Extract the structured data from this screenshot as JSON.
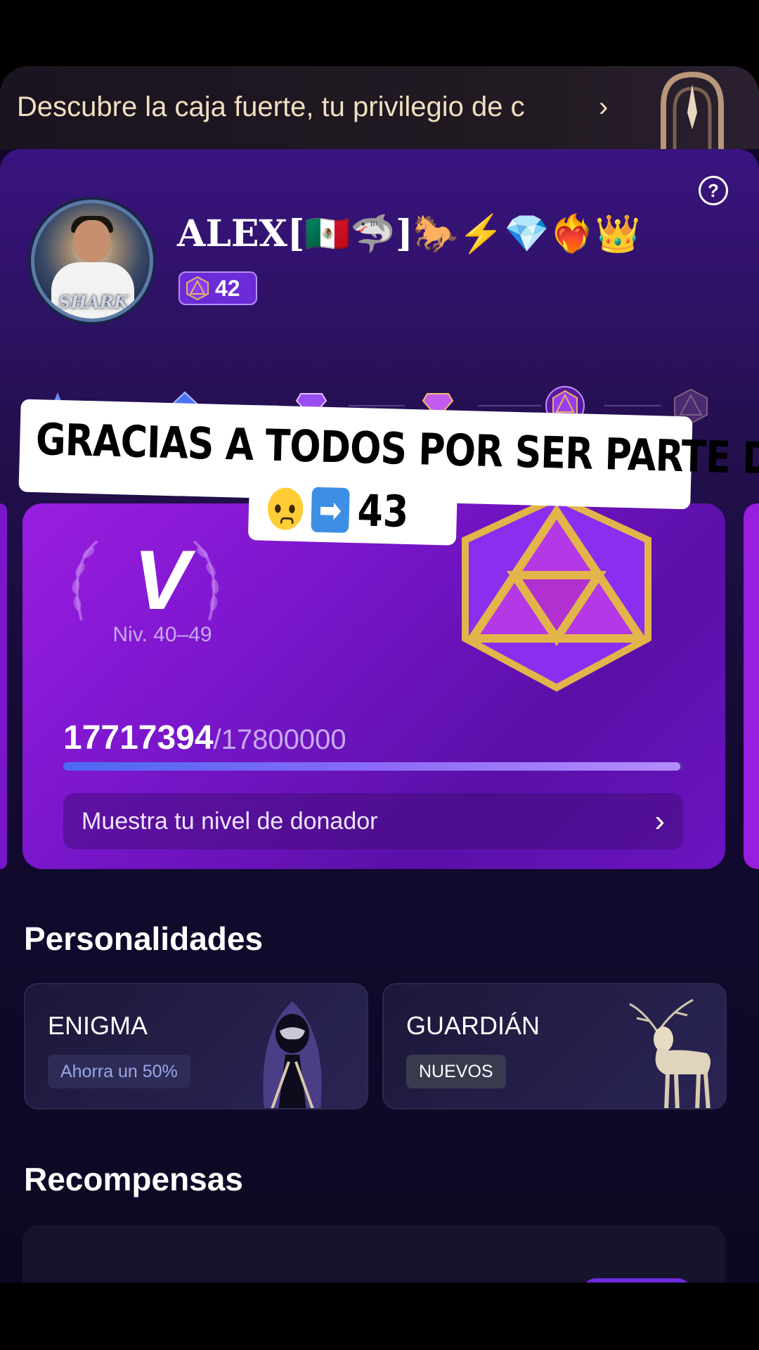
{
  "banner": {
    "text": "Descubre la caja fuerte, tu privilegio de c",
    "chevron": "›"
  },
  "help_glyph": "?",
  "profile": {
    "username": "ALEX[🇲🇽🦈]🐎⚡💎❤️‍🔥👑",
    "level": "42",
    "avatar_text": "SHARK"
  },
  "overlay": {
    "line1": "GRACIAS A TODOS POR SER PARTE DE",
    "line2_number": "43",
    "arrow": "➡"
  },
  "level_card": {
    "tier": "V",
    "range": "Niv. 40–49",
    "current": "17717394",
    "max": "/17800000",
    "progress_fraction": 0.9954,
    "show_label": "Muestra tu nivel de donador",
    "chevron": "›"
  },
  "personalities": {
    "title": "Personalidades",
    "items": [
      {
        "name": "ENIGMA",
        "tag": "Ahorra un 50%"
      },
      {
        "name": "GUARDIÁN",
        "tag": "NUEVOS"
      }
    ]
  },
  "rewards": {
    "title": "Recompensas"
  },
  "colors": {
    "accent": "#9a1ee0",
    "gold": "#d9b24a",
    "badge": "#6b2bd6"
  }
}
